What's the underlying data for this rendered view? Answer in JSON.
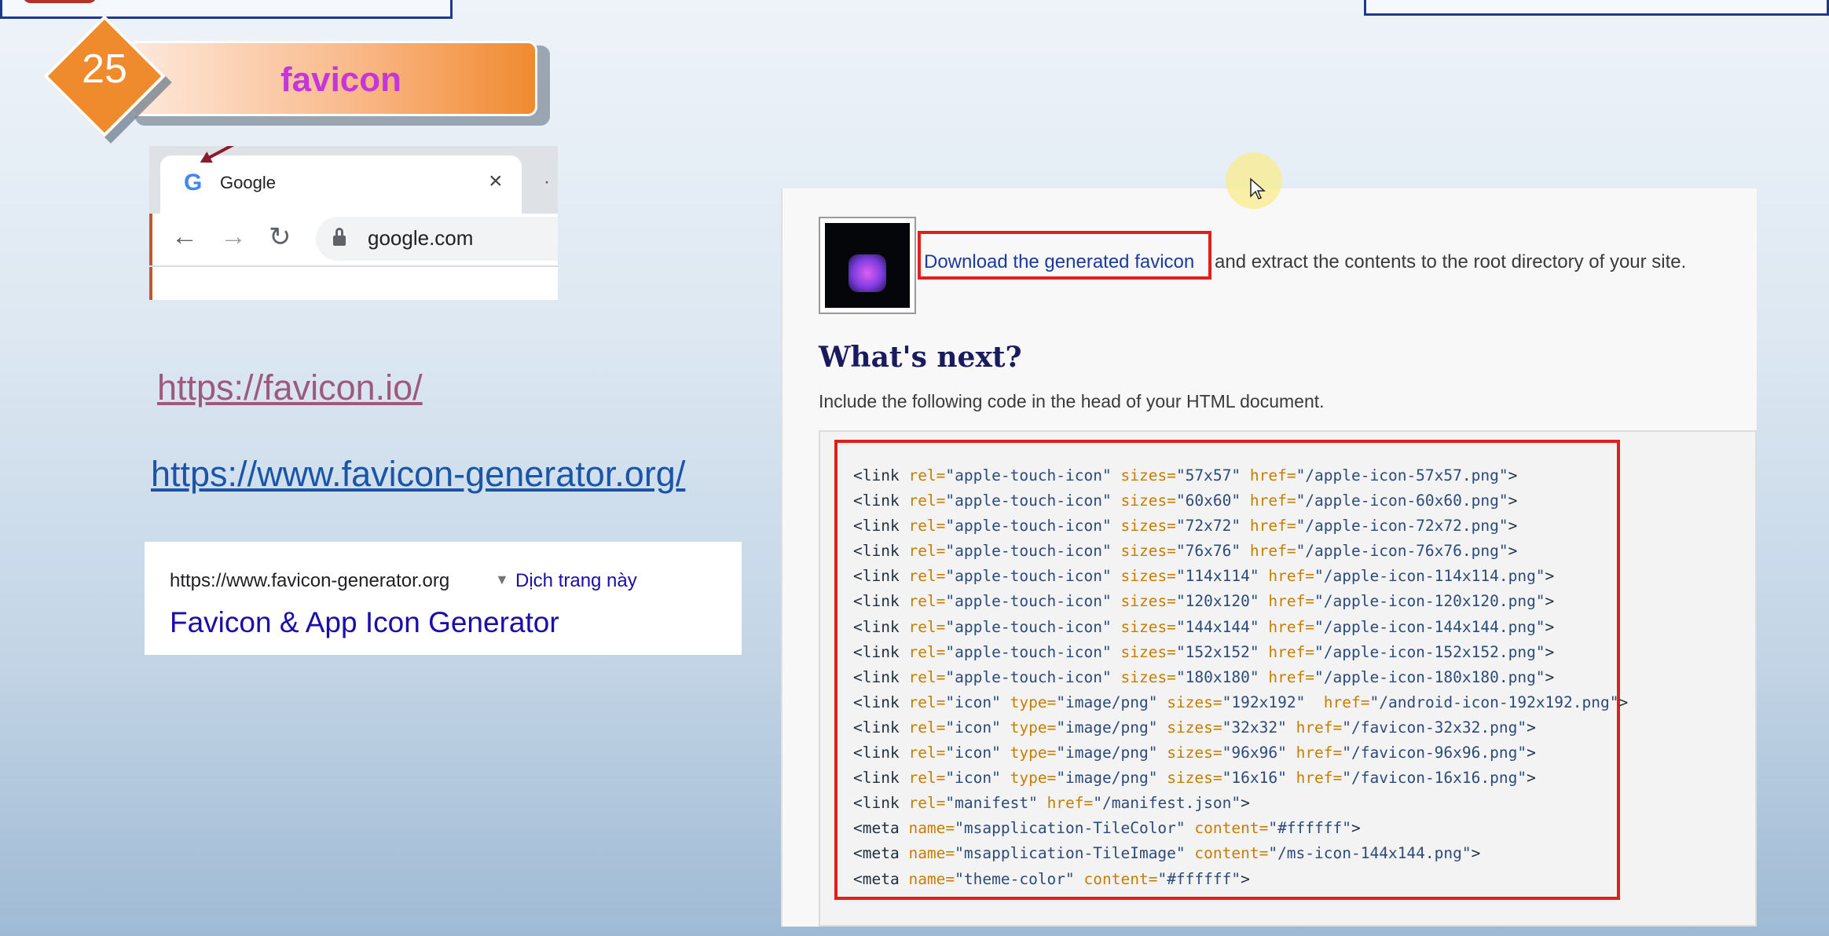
{
  "slide": {
    "number": "25",
    "title": "favicon"
  },
  "browser_tab": {
    "tab_title": "Google",
    "url": "google.com",
    "close_glyph": "×"
  },
  "links": {
    "favicon_io": "https://favicon.io/",
    "favicon_generator": "https://www.favicon-generator.org/"
  },
  "search_result": {
    "url": "https://www.favicon-generator.org",
    "translate": "Dịch trang này",
    "title": "Favicon & App Icon Generator"
  },
  "panel": {
    "download_link": "Download the generated favicon",
    "download_rest": "and extract the contents to the root directory of your site.",
    "heading": "What's next?",
    "instruction": "Include the following code in the head of your HTML document.",
    "code_lines": [
      [
        [
          "tg",
          "<link "
        ],
        [
          "at",
          "rel="
        ],
        [
          "vl",
          "\"apple-touch-icon\" "
        ],
        [
          "at",
          "sizes="
        ],
        [
          "vl",
          "\"57x57\" "
        ],
        [
          "at",
          "href="
        ],
        [
          "vl",
          "\"/apple-icon-57x57.png\""
        ],
        [
          "tg",
          ">"
        ]
      ],
      [
        [
          "tg",
          "<link "
        ],
        [
          "at",
          "rel="
        ],
        [
          "vl",
          "\"apple-touch-icon\" "
        ],
        [
          "at",
          "sizes="
        ],
        [
          "vl",
          "\"60x60\" "
        ],
        [
          "at",
          "href="
        ],
        [
          "vl",
          "\"/apple-icon-60x60.png\""
        ],
        [
          "tg",
          ">"
        ]
      ],
      [
        [
          "tg",
          "<link "
        ],
        [
          "at",
          "rel="
        ],
        [
          "vl",
          "\"apple-touch-icon\" "
        ],
        [
          "at",
          "sizes="
        ],
        [
          "vl",
          "\"72x72\" "
        ],
        [
          "at",
          "href="
        ],
        [
          "vl",
          "\"/apple-icon-72x72.png\""
        ],
        [
          "tg",
          ">"
        ]
      ],
      [
        [
          "tg",
          "<link "
        ],
        [
          "at",
          "rel="
        ],
        [
          "vl",
          "\"apple-touch-icon\" "
        ],
        [
          "at",
          "sizes="
        ],
        [
          "vl",
          "\"76x76\" "
        ],
        [
          "at",
          "href="
        ],
        [
          "vl",
          "\"/apple-icon-76x76.png\""
        ],
        [
          "tg",
          ">"
        ]
      ],
      [
        [
          "tg",
          "<link "
        ],
        [
          "at",
          "rel="
        ],
        [
          "vl",
          "\"apple-touch-icon\" "
        ],
        [
          "at",
          "sizes="
        ],
        [
          "vl",
          "\"114x114\" "
        ],
        [
          "at",
          "href="
        ],
        [
          "vl",
          "\"/apple-icon-114x114.png\""
        ],
        [
          "tg",
          ">"
        ]
      ],
      [
        [
          "tg",
          "<link "
        ],
        [
          "at",
          "rel="
        ],
        [
          "vl",
          "\"apple-touch-icon\" "
        ],
        [
          "at",
          "sizes="
        ],
        [
          "vl",
          "\"120x120\" "
        ],
        [
          "at",
          "href="
        ],
        [
          "vl",
          "\"/apple-icon-120x120.png\""
        ],
        [
          "tg",
          ">"
        ]
      ],
      [
        [
          "tg",
          "<link "
        ],
        [
          "at",
          "rel="
        ],
        [
          "vl",
          "\"apple-touch-icon\" "
        ],
        [
          "at",
          "sizes="
        ],
        [
          "vl",
          "\"144x144\" "
        ],
        [
          "at",
          "href="
        ],
        [
          "vl",
          "\"/apple-icon-144x144.png\""
        ],
        [
          "tg",
          ">"
        ]
      ],
      [
        [
          "tg",
          "<link "
        ],
        [
          "at",
          "rel="
        ],
        [
          "vl",
          "\"apple-touch-icon\" "
        ],
        [
          "at",
          "sizes="
        ],
        [
          "vl",
          "\"152x152\" "
        ],
        [
          "at",
          "href="
        ],
        [
          "vl",
          "\"/apple-icon-152x152.png\""
        ],
        [
          "tg",
          ">"
        ]
      ],
      [
        [
          "tg",
          "<link "
        ],
        [
          "at",
          "rel="
        ],
        [
          "vl",
          "\"apple-touch-icon\" "
        ],
        [
          "at",
          "sizes="
        ],
        [
          "vl",
          "\"180x180\" "
        ],
        [
          "at",
          "href="
        ],
        [
          "vl",
          "\"/apple-icon-180x180.png\""
        ],
        [
          "tg",
          ">"
        ]
      ],
      [
        [
          "tg",
          "<link "
        ],
        [
          "at",
          "rel="
        ],
        [
          "vl",
          "\"icon\" "
        ],
        [
          "at",
          "type="
        ],
        [
          "vl",
          "\"image/png\" "
        ],
        [
          "at",
          "sizes="
        ],
        [
          "vl",
          "\"192x192\"  "
        ],
        [
          "at",
          "href="
        ],
        [
          "vl",
          "\"/android-icon-192x192.png\""
        ],
        [
          "tg",
          ">"
        ]
      ],
      [
        [
          "tg",
          "<link "
        ],
        [
          "at",
          "rel="
        ],
        [
          "vl",
          "\"icon\" "
        ],
        [
          "at",
          "type="
        ],
        [
          "vl",
          "\"image/png\" "
        ],
        [
          "at",
          "sizes="
        ],
        [
          "vl",
          "\"32x32\" "
        ],
        [
          "at",
          "href="
        ],
        [
          "vl",
          "\"/favicon-32x32.png\""
        ],
        [
          "tg",
          ">"
        ]
      ],
      [
        [
          "tg",
          "<link "
        ],
        [
          "at",
          "rel="
        ],
        [
          "vl",
          "\"icon\" "
        ],
        [
          "at",
          "type="
        ],
        [
          "vl",
          "\"image/png\" "
        ],
        [
          "at",
          "sizes="
        ],
        [
          "vl",
          "\"96x96\" "
        ],
        [
          "at",
          "href="
        ],
        [
          "vl",
          "\"/favicon-96x96.png\""
        ],
        [
          "tg",
          ">"
        ]
      ],
      [
        [
          "tg",
          "<link "
        ],
        [
          "at",
          "rel="
        ],
        [
          "vl",
          "\"icon\" "
        ],
        [
          "at",
          "type="
        ],
        [
          "vl",
          "\"image/png\" "
        ],
        [
          "at",
          "sizes="
        ],
        [
          "vl",
          "\"16x16\" "
        ],
        [
          "at",
          "href="
        ],
        [
          "vl",
          "\"/favicon-16x16.png\""
        ],
        [
          "tg",
          ">"
        ]
      ],
      [
        [
          "tg",
          "<link "
        ],
        [
          "at",
          "rel="
        ],
        [
          "vl",
          "\"manifest\" "
        ],
        [
          "at",
          "href="
        ],
        [
          "vl",
          "\"/manifest.json\""
        ],
        [
          "tg",
          ">"
        ]
      ],
      [
        [
          "tg",
          "<meta "
        ],
        [
          "at",
          "name="
        ],
        [
          "vl",
          "\"msapplication-TileColor\" "
        ],
        [
          "at",
          "content="
        ],
        [
          "vl",
          "\"#ffffff\""
        ],
        [
          "tg",
          ">"
        ]
      ],
      [
        [
          "tg",
          "<meta "
        ],
        [
          "at",
          "name="
        ],
        [
          "vl",
          "\"msapplication-TileImage\" "
        ],
        [
          "at",
          "content="
        ],
        [
          "vl",
          "\"/ms-icon-144x144.png\""
        ],
        [
          "tg",
          ">"
        ]
      ],
      [
        [
          "tg",
          "<meta "
        ],
        [
          "at",
          "name="
        ],
        [
          "vl",
          "\"theme-color\" "
        ],
        [
          "at",
          "content="
        ],
        [
          "vl",
          "\"#ffffff\""
        ],
        [
          "tg",
          ">"
        ]
      ]
    ]
  },
  "icons": {
    "diamond_badge": "diamond-badge",
    "google_favicon": "google-g-icon",
    "back": "arrow-left-icon",
    "forward": "arrow-right-icon",
    "reload": "reload-icon",
    "lock": "lock-icon",
    "dropdown": "caret-down-icon",
    "cursor": "mouse-cursor-icon"
  },
  "colors": {
    "accent_orange": "#ef8b2c",
    "title_magenta": "#c436d8",
    "highlight_red": "#e0201c",
    "link_blue": "#1a0dab"
  }
}
